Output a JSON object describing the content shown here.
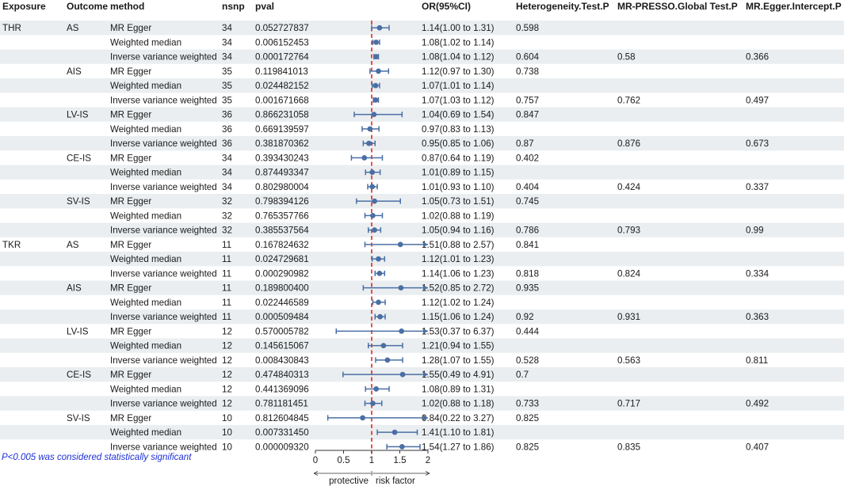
{
  "chart_data": {
    "type": "forest",
    "headers": {
      "exposure": "Exposure",
      "outcome": "Outcome",
      "method": "method",
      "nsnp": "nsnp",
      "pval": "pval",
      "or": "OR(95%CI)",
      "het": "Heterogeneity.Test.P",
      "presso": "MR-PRESSO.Global Test.P",
      "egger": "MR.Egger.Intercept.P"
    },
    "xlim": [
      0,
      2
    ],
    "ticks": [
      "0",
      "0.5",
      "1",
      "1.5",
      "2"
    ],
    "tick_values": [
      0,
      0.5,
      1,
      1.5,
      2
    ],
    "null_value": 1,
    "left_label": "protective",
    "right_label": "risk factor",
    "footnote": "P<0.005 was considered statistically significant",
    "rows": [
      {
        "exposure": "THR",
        "outcome": "AS",
        "method": "MR Egger",
        "nsnp": "34",
        "pval": "0.052727837",
        "or_text": "1.14(1.00 to 1.31)",
        "or": 1.14,
        "lo": 1.0,
        "hi": 1.31,
        "het": "0.598",
        "presso": "",
        "egger": ""
      },
      {
        "exposure": "",
        "outcome": "",
        "method": "Weighted median",
        "nsnp": "34",
        "pval": "0.006152453",
        "or_text": "1.08(1.02 to 1.14)",
        "or": 1.08,
        "lo": 1.02,
        "hi": 1.14,
        "het": "",
        "presso": "",
        "egger": ""
      },
      {
        "exposure": "",
        "outcome": "",
        "method": "Inverse variance weighted",
        "nsnp": "34",
        "pval": "0.000172764",
        "or_text": "1.08(1.04 to 1.12)",
        "or": 1.08,
        "lo": 1.04,
        "hi": 1.12,
        "het": "0.604",
        "presso": "0.58",
        "egger": "0.366"
      },
      {
        "exposure": "",
        "outcome": "AIS",
        "method": "MR Egger",
        "nsnp": "35",
        "pval": "0.119841013",
        "or_text": "1.12(0.97 to 1.30)",
        "or": 1.12,
        "lo": 0.97,
        "hi": 1.3,
        "het": "0.738",
        "presso": "",
        "egger": ""
      },
      {
        "exposure": "",
        "outcome": "",
        "method": "Weighted median",
        "nsnp": "35",
        "pval": "0.024482152",
        "or_text": "1.07(1.01 to 1.14)",
        "or": 1.07,
        "lo": 1.01,
        "hi": 1.14,
        "het": "",
        "presso": "",
        "egger": ""
      },
      {
        "exposure": "",
        "outcome": "",
        "method": "Inverse variance weighted",
        "nsnp": "35",
        "pval": "0.001671668",
        "or_text": "1.07(1.03 to 1.12)",
        "or": 1.07,
        "lo": 1.03,
        "hi": 1.12,
        "het": "0.757",
        "presso": "0.762",
        "egger": "0.497"
      },
      {
        "exposure": "",
        "outcome": "LV-IS",
        "method": "MR Egger",
        "nsnp": "36",
        "pval": "0.866231058",
        "or_text": "1.04(0.69 to 1.54)",
        "or": 1.04,
        "lo": 0.69,
        "hi": 1.54,
        "het": "0.847",
        "presso": "",
        "egger": ""
      },
      {
        "exposure": "",
        "outcome": "",
        "method": "Weighted median",
        "nsnp": "36",
        "pval": "0.669139597",
        "or_text": "0.97(0.83 to 1.13)",
        "or": 0.97,
        "lo": 0.83,
        "hi": 1.13,
        "het": "",
        "presso": "",
        "egger": ""
      },
      {
        "exposure": "",
        "outcome": "",
        "method": "Inverse variance weighted",
        "nsnp": "36",
        "pval": "0.381870362",
        "or_text": "0.95(0.85 to 1.06)",
        "or": 0.95,
        "lo": 0.85,
        "hi": 1.06,
        "het": "0.87",
        "presso": "0.876",
        "egger": "0.673"
      },
      {
        "exposure": "",
        "outcome": "CE-IS",
        "method": "MR Egger",
        "nsnp": "34",
        "pval": "0.393430243",
        "or_text": "0.87(0.64 to 1.19)",
        "or": 0.87,
        "lo": 0.64,
        "hi": 1.19,
        "het": "0.402",
        "presso": "",
        "egger": ""
      },
      {
        "exposure": "",
        "outcome": "",
        "method": "Weighted median",
        "nsnp": "34",
        "pval": "0.874493347",
        "or_text": "1.01(0.89 to 1.15)",
        "or": 1.01,
        "lo": 0.89,
        "hi": 1.15,
        "het": "",
        "presso": "",
        "egger": ""
      },
      {
        "exposure": "",
        "outcome": "",
        "method": "Inverse variance weighted",
        "nsnp": "34",
        "pval": "0.802980004",
        "or_text": "1.01(0.93 to 1.10)",
        "or": 1.01,
        "lo": 0.93,
        "hi": 1.1,
        "het": "0.404",
        "presso": "0.424",
        "egger": "0.337"
      },
      {
        "exposure": "",
        "outcome": "SV-IS",
        "method": "MR Egger",
        "nsnp": "32",
        "pval": "0.798394126",
        "or_text": "1.05(0.73 to 1.51)",
        "or": 1.05,
        "lo": 0.73,
        "hi": 1.51,
        "het": "0.745",
        "presso": "",
        "egger": ""
      },
      {
        "exposure": "",
        "outcome": "",
        "method": "Weighted median",
        "nsnp": "32",
        "pval": "0.765357766",
        "or_text": "1.02(0.88 to 1.19)",
        "or": 1.02,
        "lo": 0.88,
        "hi": 1.19,
        "het": "",
        "presso": "",
        "egger": ""
      },
      {
        "exposure": "",
        "outcome": "",
        "method": "Inverse variance weighted",
        "nsnp": "32",
        "pval": "0.385537564",
        "or_text": "1.05(0.94 to 1.16)",
        "or": 1.05,
        "lo": 0.94,
        "hi": 1.16,
        "het": "0.786",
        "presso": "0.793",
        "egger": "0.99"
      },
      {
        "exposure": "TKR",
        "outcome": "AS",
        "method": "MR Egger",
        "nsnp": "11",
        "pval": "0.167824632",
        "or_text": "1.51(0.88 to 2.57)",
        "or": 1.51,
        "lo": 0.88,
        "hi": 2.57,
        "het": "0.841",
        "presso": "",
        "egger": ""
      },
      {
        "exposure": "",
        "outcome": "",
        "method": "Weighted median",
        "nsnp": "11",
        "pval": "0.024729681",
        "or_text": "1.12(1.01 to 1.23)",
        "or": 1.12,
        "lo": 1.01,
        "hi": 1.23,
        "het": "",
        "presso": "",
        "egger": ""
      },
      {
        "exposure": "",
        "outcome": "",
        "method": "Inverse variance weighted",
        "nsnp": "11",
        "pval": "0.000290982",
        "or_text": "1.14(1.06 to 1.23)",
        "or": 1.14,
        "lo": 1.06,
        "hi": 1.23,
        "het": "0.818",
        "presso": "0.824",
        "egger": "0.334"
      },
      {
        "exposure": "",
        "outcome": "AIS",
        "method": "MR Egger",
        "nsnp": "11",
        "pval": "0.189800400",
        "or_text": "1.52(0.85 to 2.72)",
        "or": 1.52,
        "lo": 0.85,
        "hi": 2.72,
        "het": "0.935",
        "presso": "",
        "egger": ""
      },
      {
        "exposure": "",
        "outcome": "",
        "method": "Weighted median",
        "nsnp": "11",
        "pval": "0.022446589",
        "or_text": "1.12(1.02 to 1.24)",
        "or": 1.12,
        "lo": 1.02,
        "hi": 1.24,
        "het": "",
        "presso": "",
        "egger": ""
      },
      {
        "exposure": "",
        "outcome": "",
        "method": "Inverse variance weighted",
        "nsnp": "11",
        "pval": "0.000509484",
        "or_text": "1.15(1.06 to 1.24)",
        "or": 1.15,
        "lo": 1.06,
        "hi": 1.24,
        "het": "0.92",
        "presso": "0.931",
        "egger": "0.363"
      },
      {
        "exposure": "",
        "outcome": "LV-IS",
        "method": "MR Egger",
        "nsnp": "12",
        "pval": "0.570005782",
        "or_text": "1.53(0.37 to 6.37)",
        "or": 1.53,
        "lo": 0.37,
        "hi": 6.37,
        "het": "0.444",
        "presso": "",
        "egger": ""
      },
      {
        "exposure": "",
        "outcome": "",
        "method": "Weighted median",
        "nsnp": "12",
        "pval": "0.145615067",
        "or_text": "1.21(0.94 to 1.55)",
        "or": 1.21,
        "lo": 0.94,
        "hi": 1.55,
        "het": "",
        "presso": "",
        "egger": ""
      },
      {
        "exposure": "",
        "outcome": "",
        "method": "Inverse variance weighted",
        "nsnp": "12",
        "pval": "0.008430843",
        "or_text": "1.28(1.07 to 1.55)",
        "or": 1.28,
        "lo": 1.07,
        "hi": 1.55,
        "het": "0.528",
        "presso": "0.563",
        "egger": "0.811"
      },
      {
        "exposure": "",
        "outcome": "CE-IS",
        "method": "MR Egger",
        "nsnp": "12",
        "pval": "0.474840313",
        "or_text": "1.55(0.49 to 4.91)",
        "or": 1.55,
        "lo": 0.49,
        "hi": 4.91,
        "het": "0.7",
        "presso": "",
        "egger": ""
      },
      {
        "exposure": "",
        "outcome": "",
        "method": "Weighted median",
        "nsnp": "12",
        "pval": "0.441369096",
        "or_text": "1.08(0.89 to 1.31)",
        "or": 1.08,
        "lo": 0.89,
        "hi": 1.31,
        "het": "",
        "presso": "",
        "egger": ""
      },
      {
        "exposure": "",
        "outcome": "",
        "method": "Inverse variance weighted",
        "nsnp": "12",
        "pval": "0.781181451",
        "or_text": "1.02(0.88 to 1.18)",
        "or": 1.02,
        "lo": 0.88,
        "hi": 1.18,
        "het": "0.733",
        "presso": "0.717",
        "egger": "0.492"
      },
      {
        "exposure": "",
        "outcome": "SV-IS",
        "method": "MR Egger",
        "nsnp": "10",
        "pval": "0.812604845",
        "or_text": "0.84(0.22 to 3.27)",
        "or": 0.84,
        "lo": 0.22,
        "hi": 3.27,
        "het": "0.825",
        "presso": "",
        "egger": ""
      },
      {
        "exposure": "",
        "outcome": "",
        "method": "Weighted median",
        "nsnp": "10",
        "pval": "0.007331450",
        "or_text": "1.41(1.10 to 1.81)",
        "or": 1.41,
        "lo": 1.1,
        "hi": 1.81,
        "het": "",
        "presso": "",
        "egger": ""
      },
      {
        "exposure": "",
        "outcome": "",
        "method": "Inverse variance weighted",
        "nsnp": "10",
        "pval": "0.000009320",
        "or_text": "1.54(1.27 to 1.86)",
        "or": 1.54,
        "lo": 1.27,
        "hi": 1.86,
        "het": "0.825",
        "presso": "0.835",
        "egger": "0.407"
      }
    ],
    "colors": {
      "point": "#4a6fa5",
      "ci": "#4a6fa5",
      "null_line": "#e8241c",
      "stripe": "#eaeef0",
      "axis": "#333333",
      "footnote": "#1c2fd6"
    }
  }
}
